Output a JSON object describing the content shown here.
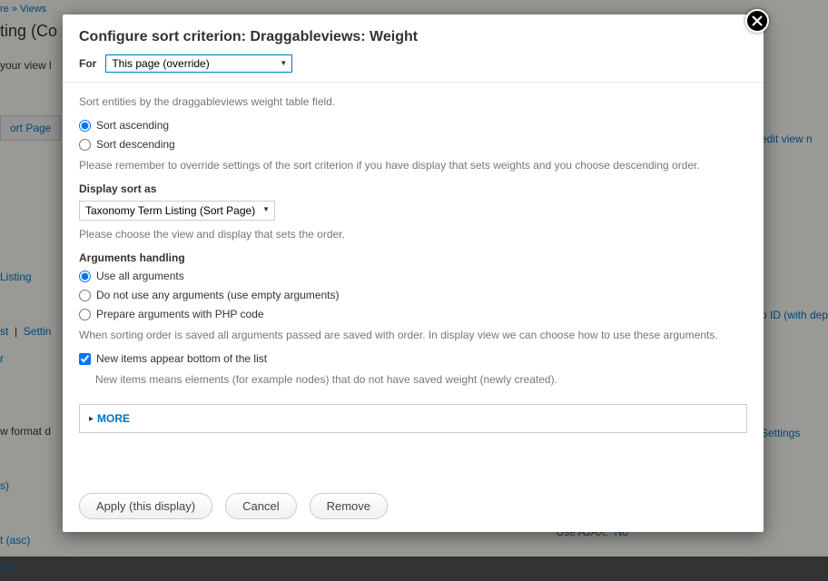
{
  "bg": {
    "breadcrumb_sep": " » ",
    "breadcrumb_views": "Views",
    "title_fragment": "ting (Co",
    "your_view": "your view l",
    "sort_page_tab": "ort Page",
    "edit_view": "edit view n",
    "listing": "Listing",
    "st": "st",
    "settin": "Settin",
    "r": "r",
    "id_dep": "o ID (with dep",
    "settings": "Settings",
    "row_format": "w format d",
    "s_paren": "s)",
    "t_asc": "t (asc)",
    "asc_paren": "sc)",
    "use_ajax_label": "Use AJAX:",
    "use_ajax_value": "No"
  },
  "modal": {
    "title": "Configure sort criterion: Draggableviews: Weight",
    "for_label": "For",
    "for_value": "This page (override)",
    "intro": "Sort entities by the draggableviews weight table field.",
    "sort_asc": "Sort ascending",
    "sort_desc": "Sort descending",
    "sort_help": "Please remember to override settings of the sort criterion if you have display that sets weights and you choose descending order.",
    "display_sort_label": "Display sort as",
    "display_sort_value": "Taxonomy Term Listing (Sort Page)",
    "display_sort_help": "Please choose the view and display that sets the order.",
    "args_label": "Arguments handling",
    "args_opt1": "Use all arguments",
    "args_opt2": "Do not use any arguments (use empty arguments)",
    "args_opt3": "Prepare arguments with PHP code",
    "args_help": "When sorting order is saved all arguments passed are saved with order. In display view we can choose how to use these arguments.",
    "new_items_label": "New items appear bottom of the list",
    "new_items_help": "New items means elements (for example nodes) that do not have saved weight (newly created).",
    "more": "MORE",
    "btn_apply": "Apply (this display)",
    "btn_cancel": "Cancel",
    "btn_remove": "Remove"
  }
}
